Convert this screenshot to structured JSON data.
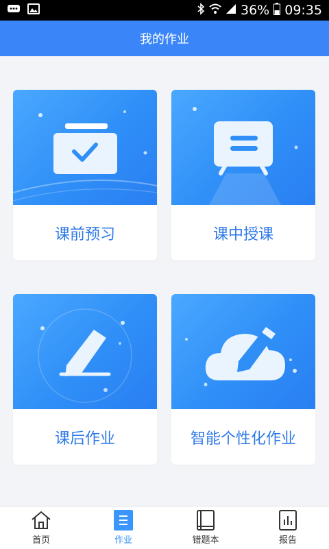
{
  "statusbar": {
    "battery": "36%",
    "time": "09:35"
  },
  "header": {
    "title": "我的作业"
  },
  "cards": [
    {
      "label": "课前预习"
    },
    {
      "label": "课中授课"
    },
    {
      "label": "课后作业"
    },
    {
      "label": "智能个性化作业"
    }
  ],
  "tabbar": {
    "items": [
      {
        "label": "首页",
        "icon": "home-icon"
      },
      {
        "label": "作业",
        "icon": "homework-icon"
      },
      {
        "label": "错题本",
        "icon": "notebook-icon"
      },
      {
        "label": "报告",
        "icon": "report-icon"
      }
    ]
  },
  "colors": {
    "primary": "#3a86f8",
    "label": "#2d78e8"
  }
}
